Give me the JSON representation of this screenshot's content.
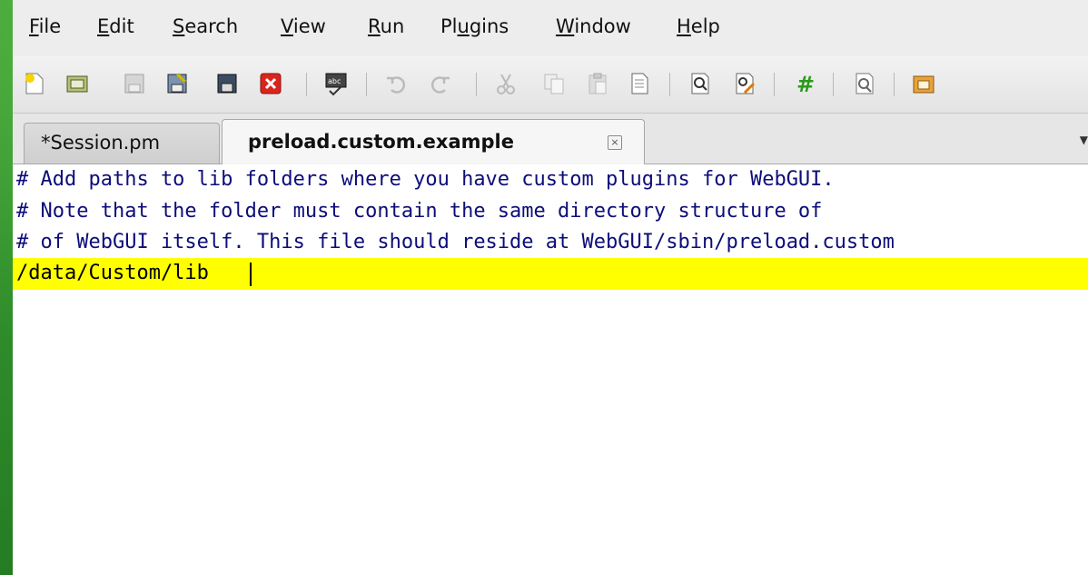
{
  "menu": {
    "items": [
      {
        "label": "File",
        "mnemonic": "F",
        "rest": "ile"
      },
      {
        "label": "Edit",
        "mnemonic": "E",
        "rest": "dit"
      },
      {
        "label": "Search",
        "mnemonic": "S",
        "rest": "earch"
      },
      {
        "label": "View",
        "mnemonic": "V",
        "rest": "iew"
      },
      {
        "label": "Run",
        "mnemonic": "R",
        "rest": "un"
      },
      {
        "label": "Plugins",
        "pre": "Pl",
        "mnemonic": "u",
        "rest": "gins"
      },
      {
        "label": "Window",
        "mnemonic": "W",
        "rest": "indow"
      },
      {
        "label": "Help",
        "mnemonic": "H",
        "rest": "elp"
      }
    ]
  },
  "toolbar": {
    "buttons": [
      "new-file-icon",
      "open-file-icon",
      "save-icon",
      "save-as-icon",
      "save-all-icon",
      "close-icon",
      "spellcheck-icon",
      "undo-icon",
      "redo-icon",
      "cut-icon",
      "copy-icon",
      "paste-icon",
      "select-all-icon",
      "find-icon",
      "replace-icon",
      "comment-icon",
      "zoom-icon",
      "open-folder-icon"
    ]
  },
  "tabs": [
    {
      "label": "*Session.pm",
      "active": false
    },
    {
      "label": "preload.custom.example",
      "active": true
    }
  ],
  "editor": {
    "lines": [
      "# Add paths to lib folders where you have custom plugins for WebGUI.",
      "# Note that the folder must contain the same directory structure of",
      "# of WebGUI itself. This file should reside at WebGUI/sbin/preload.custom",
      "/data/Custom/lib"
    ],
    "current_line_color": "#ffff00",
    "comment_color": "#0d0d7a"
  }
}
